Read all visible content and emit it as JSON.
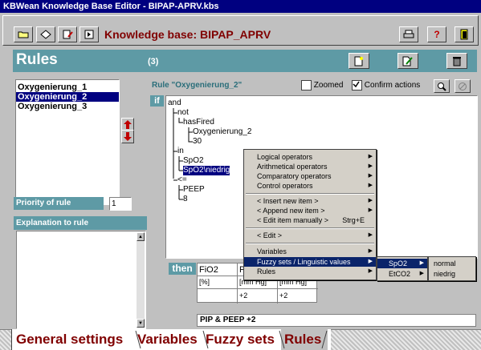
{
  "window": {
    "title": "KBWean Knowledge Base Editor - BIPAP-APRV.kbs"
  },
  "toolbar": {
    "kb_label": "Knowledge base: BIPAP_APRV"
  },
  "rules_header": {
    "title": "Rules",
    "count": "(3)"
  },
  "rule_list": {
    "items": [
      "Oxygenierung_1",
      "Oxygenierung_2",
      "Oxygenierung_3"
    ],
    "selected_index": 1
  },
  "rule_panel": {
    "title": "Rule \"Oxygenierung_2\"",
    "zoomed_label": "Zoomed",
    "zoomed": false,
    "confirm_label": "Confirm actions",
    "confirm": true
  },
  "priority": {
    "label": "Priority of rule",
    "value": "1"
  },
  "explanation": {
    "label": "Explanation to rule"
  },
  "if_label": "if",
  "tree": {
    "n1": "and",
    "n2": "not",
    "n3": "hasFired",
    "n4": "Oxygenierung_2",
    "n5": "30",
    "n6": "in",
    "n7": "SpO2",
    "n8": "SpO2\\niedrig",
    "n9": "<=",
    "n10": "PEEP",
    "n11": "8"
  },
  "then": {
    "label": "then",
    "headers": [
      "FiO2",
      "P",
      "P"
    ],
    "units": [
      "[%]",
      "[mm Hg]",
      "[mm Hg]"
    ],
    "values": [
      "",
      "+2",
      "+2"
    ],
    "summary": "PIP & PEEP +2"
  },
  "context_menu": {
    "logical": "Logical operators",
    "arithmetical": "Arithmetical operators",
    "comparatory": "Comparatory operators",
    "control": "Control operators",
    "insert": "< Insert new item >",
    "append": "< Append new item >",
    "edit_manual": "< Edit item manually >",
    "edit_manual_shortcut": "Strg+E",
    "edit": "< Edit >",
    "variables": "Variables",
    "fuzzy": "Fuzzy sets / Linguistic values",
    "rules": "Rules"
  },
  "submenu": {
    "spo2": "SpO2",
    "etco2": "EtCO2"
  },
  "submenu2": {
    "normal": "normal",
    "niedrig": "niedrig"
  },
  "tabs": {
    "general": "General settings",
    "variables": "Variables",
    "fuzzy": "Fuzzy sets",
    "rules": "Rules"
  },
  "colors": {
    "title_bar": "#000080",
    "teal": "#5e9aa5",
    "dark_red": "#800000",
    "highlight": "#0a246a"
  }
}
